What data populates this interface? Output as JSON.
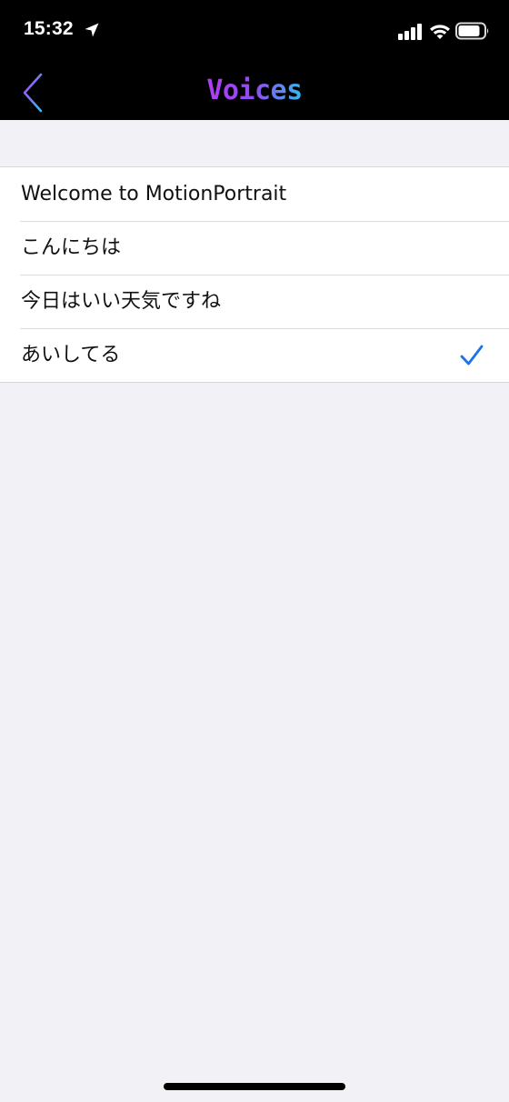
{
  "status_bar": {
    "time": "15:32",
    "icons": [
      "location-arrow-icon",
      "cellular-signal-icon",
      "wifi-icon",
      "battery-icon"
    ]
  },
  "nav": {
    "title": "Voices",
    "back_icon": "chevron-left-icon",
    "title_gradient": [
      "#b03cf6",
      "#8f4cf3",
      "#33b9ef"
    ]
  },
  "voices": {
    "items": [
      {
        "label": "Welcome to MotionPortrait",
        "selected": false
      },
      {
        "label": "こんにちは",
        "selected": false
      },
      {
        "label": "今日はいい天気ですね",
        "selected": false
      },
      {
        "label": "あいしてる",
        "selected": true
      }
    ],
    "check_icon": "checkmark-icon",
    "check_color": "#1a73e8"
  },
  "colors": {
    "background": "#f2f2f6",
    "bar": "#000000"
  }
}
